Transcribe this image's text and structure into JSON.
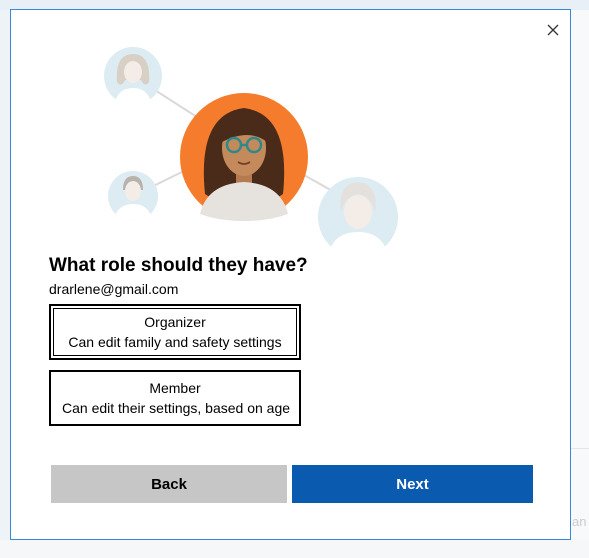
{
  "dialog": {
    "heading": "What role should they have?",
    "email": "drarlene@gmail.com",
    "roles": [
      {
        "title": "Organizer",
        "description": "Can edit family and safety settings",
        "selected": true
      },
      {
        "title": "Member",
        "description": "Can edit their settings, based on age",
        "selected": false
      }
    ],
    "back_label": "Back",
    "next_label": "Next"
  },
  "icons": [
    "close-icon",
    "family-illustration"
  ],
  "colors": {
    "accent": "#0a5ab0",
    "secondary_button": "#c6c6c6",
    "avatar_orange": "#f47c2c",
    "avatar_light_blue": "#dcecf2",
    "window_border": "#3a86d8"
  }
}
